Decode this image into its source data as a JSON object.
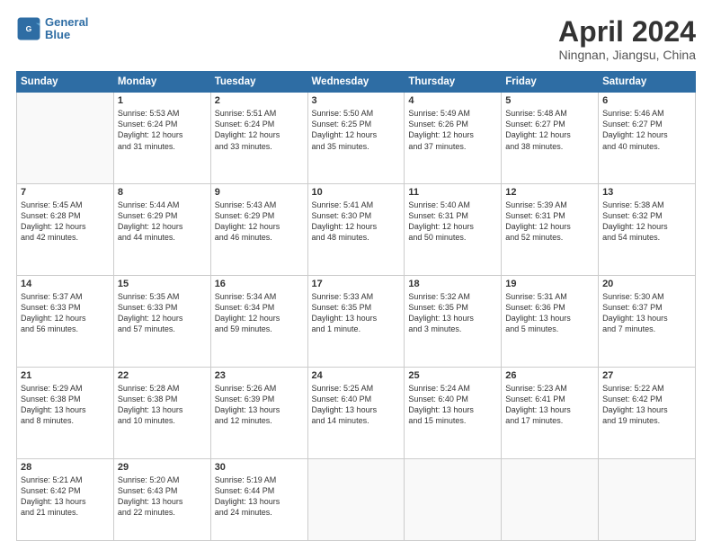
{
  "header": {
    "logo_line1": "General",
    "logo_line2": "Blue",
    "month": "April 2024",
    "location": "Ningnan, Jiangsu, China"
  },
  "weekdays": [
    "Sunday",
    "Monday",
    "Tuesday",
    "Wednesday",
    "Thursday",
    "Friday",
    "Saturday"
  ],
  "weeks": [
    [
      {
        "day": "",
        "info": ""
      },
      {
        "day": "1",
        "info": "Sunrise: 5:53 AM\nSunset: 6:24 PM\nDaylight: 12 hours\nand 31 minutes."
      },
      {
        "day": "2",
        "info": "Sunrise: 5:51 AM\nSunset: 6:24 PM\nDaylight: 12 hours\nand 33 minutes."
      },
      {
        "day": "3",
        "info": "Sunrise: 5:50 AM\nSunset: 6:25 PM\nDaylight: 12 hours\nand 35 minutes."
      },
      {
        "day": "4",
        "info": "Sunrise: 5:49 AM\nSunset: 6:26 PM\nDaylight: 12 hours\nand 37 minutes."
      },
      {
        "day": "5",
        "info": "Sunrise: 5:48 AM\nSunset: 6:27 PM\nDaylight: 12 hours\nand 38 minutes."
      },
      {
        "day": "6",
        "info": "Sunrise: 5:46 AM\nSunset: 6:27 PM\nDaylight: 12 hours\nand 40 minutes."
      }
    ],
    [
      {
        "day": "7",
        "info": "Sunrise: 5:45 AM\nSunset: 6:28 PM\nDaylight: 12 hours\nand 42 minutes."
      },
      {
        "day": "8",
        "info": "Sunrise: 5:44 AM\nSunset: 6:29 PM\nDaylight: 12 hours\nand 44 minutes."
      },
      {
        "day": "9",
        "info": "Sunrise: 5:43 AM\nSunset: 6:29 PM\nDaylight: 12 hours\nand 46 minutes."
      },
      {
        "day": "10",
        "info": "Sunrise: 5:41 AM\nSunset: 6:30 PM\nDaylight: 12 hours\nand 48 minutes."
      },
      {
        "day": "11",
        "info": "Sunrise: 5:40 AM\nSunset: 6:31 PM\nDaylight: 12 hours\nand 50 minutes."
      },
      {
        "day": "12",
        "info": "Sunrise: 5:39 AM\nSunset: 6:31 PM\nDaylight: 12 hours\nand 52 minutes."
      },
      {
        "day": "13",
        "info": "Sunrise: 5:38 AM\nSunset: 6:32 PM\nDaylight: 12 hours\nand 54 minutes."
      }
    ],
    [
      {
        "day": "14",
        "info": "Sunrise: 5:37 AM\nSunset: 6:33 PM\nDaylight: 12 hours\nand 56 minutes."
      },
      {
        "day": "15",
        "info": "Sunrise: 5:35 AM\nSunset: 6:33 PM\nDaylight: 12 hours\nand 57 minutes."
      },
      {
        "day": "16",
        "info": "Sunrise: 5:34 AM\nSunset: 6:34 PM\nDaylight: 12 hours\nand 59 minutes."
      },
      {
        "day": "17",
        "info": "Sunrise: 5:33 AM\nSunset: 6:35 PM\nDaylight: 13 hours\nand 1 minute."
      },
      {
        "day": "18",
        "info": "Sunrise: 5:32 AM\nSunset: 6:35 PM\nDaylight: 13 hours\nand 3 minutes."
      },
      {
        "day": "19",
        "info": "Sunrise: 5:31 AM\nSunset: 6:36 PM\nDaylight: 13 hours\nand 5 minutes."
      },
      {
        "day": "20",
        "info": "Sunrise: 5:30 AM\nSunset: 6:37 PM\nDaylight: 13 hours\nand 7 minutes."
      }
    ],
    [
      {
        "day": "21",
        "info": "Sunrise: 5:29 AM\nSunset: 6:38 PM\nDaylight: 13 hours\nand 8 minutes."
      },
      {
        "day": "22",
        "info": "Sunrise: 5:28 AM\nSunset: 6:38 PM\nDaylight: 13 hours\nand 10 minutes."
      },
      {
        "day": "23",
        "info": "Sunrise: 5:26 AM\nSunset: 6:39 PM\nDaylight: 13 hours\nand 12 minutes."
      },
      {
        "day": "24",
        "info": "Sunrise: 5:25 AM\nSunset: 6:40 PM\nDaylight: 13 hours\nand 14 minutes."
      },
      {
        "day": "25",
        "info": "Sunrise: 5:24 AM\nSunset: 6:40 PM\nDaylight: 13 hours\nand 15 minutes."
      },
      {
        "day": "26",
        "info": "Sunrise: 5:23 AM\nSunset: 6:41 PM\nDaylight: 13 hours\nand 17 minutes."
      },
      {
        "day": "27",
        "info": "Sunrise: 5:22 AM\nSunset: 6:42 PM\nDaylight: 13 hours\nand 19 minutes."
      }
    ],
    [
      {
        "day": "28",
        "info": "Sunrise: 5:21 AM\nSunset: 6:42 PM\nDaylight: 13 hours\nand 21 minutes."
      },
      {
        "day": "29",
        "info": "Sunrise: 5:20 AM\nSunset: 6:43 PM\nDaylight: 13 hours\nand 22 minutes."
      },
      {
        "day": "30",
        "info": "Sunrise: 5:19 AM\nSunset: 6:44 PM\nDaylight: 13 hours\nand 24 minutes."
      },
      {
        "day": "",
        "info": ""
      },
      {
        "day": "",
        "info": ""
      },
      {
        "day": "",
        "info": ""
      },
      {
        "day": "",
        "info": ""
      }
    ]
  ]
}
